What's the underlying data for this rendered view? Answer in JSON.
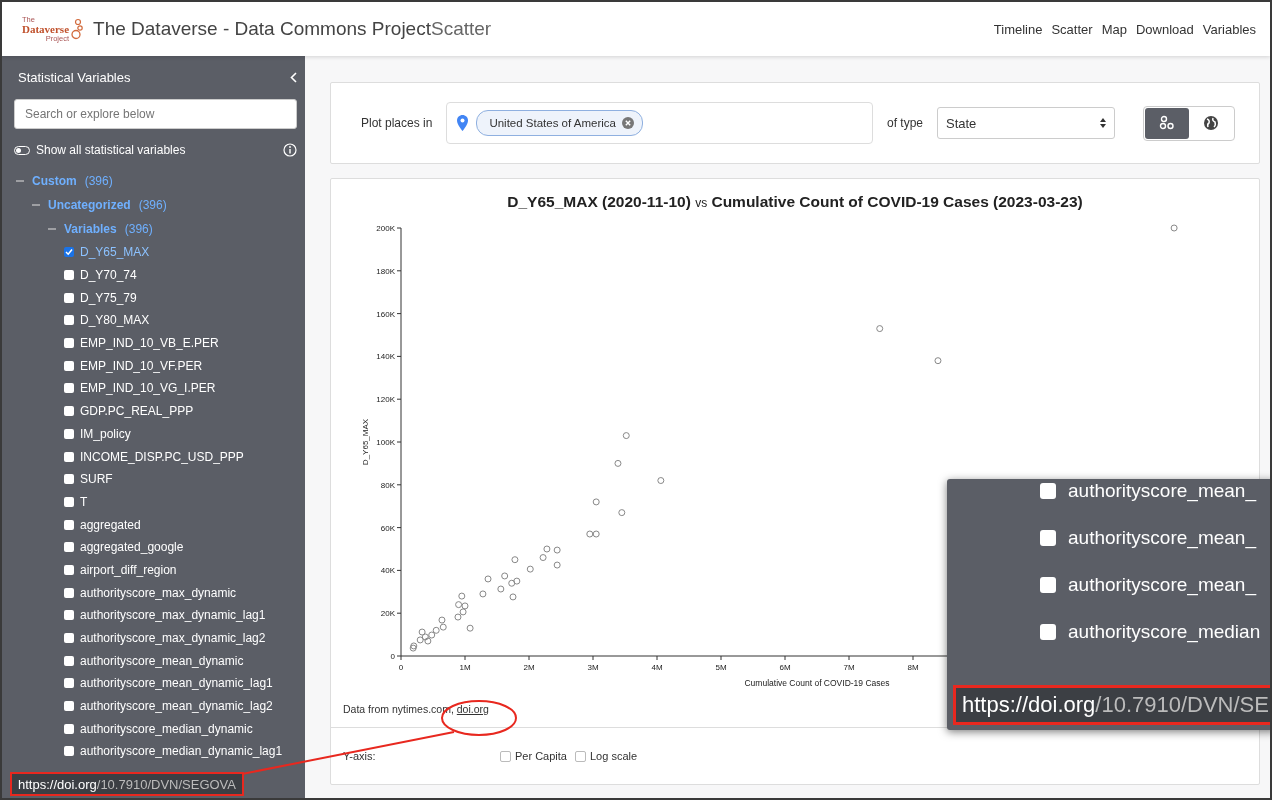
{
  "header": {
    "logo": {
      "top": "The",
      "main": "Dataverse",
      "bottom": "Project"
    },
    "title": "The Dataverse - Data Commons Project",
    "page": "Scatter",
    "nav": [
      "Timeline",
      "Scatter",
      "Map",
      "Download",
      "Variables"
    ]
  },
  "sidebar": {
    "title": "Statistical Variables",
    "search": {
      "placeholder": "Search or explore below"
    },
    "show_all": {
      "label": "Show all statistical variables",
      "on": false
    },
    "tree": [
      {
        "label": "Custom",
        "count": "(396)",
        "expanded": true,
        "children": [
          {
            "label": "Uncategorized",
            "count": "(396)",
            "expanded": true,
            "children": [
              {
                "label": "Variables",
                "count": "(396)",
                "expanded": true,
                "items": [
                  {
                    "label": "D_Y65_MAX",
                    "checked": true
                  },
                  {
                    "label": "D_Y70_74",
                    "checked": false
                  },
                  {
                    "label": "D_Y75_79",
                    "checked": false
                  },
                  {
                    "label": "D_Y80_MAX",
                    "checked": false
                  },
                  {
                    "label": "EMP_IND_10_VB_E.PER",
                    "checked": false
                  },
                  {
                    "label": "EMP_IND_10_VF.PER",
                    "checked": false
                  },
                  {
                    "label": "EMP_IND_10_VG_I.PER",
                    "checked": false
                  },
                  {
                    "label": "GDP.PC_REAL_PPP",
                    "checked": false
                  },
                  {
                    "label": "IM_policy",
                    "checked": false
                  },
                  {
                    "label": "INCOME_DISP.PC_USD_PPP",
                    "checked": false
                  },
                  {
                    "label": "SURF",
                    "checked": false
                  },
                  {
                    "label": "T",
                    "checked": false
                  },
                  {
                    "label": "aggregated",
                    "checked": false
                  },
                  {
                    "label": "aggregated_google",
                    "checked": false
                  },
                  {
                    "label": "airport_diff_region",
                    "checked": false
                  },
                  {
                    "label": "authorityscore_max_dynamic",
                    "checked": false
                  },
                  {
                    "label": "authorityscore_max_dynamic_lag1",
                    "checked": false
                  },
                  {
                    "label": "authorityscore_max_dynamic_lag2",
                    "checked": false
                  },
                  {
                    "label": "authorityscore_mean_dynamic",
                    "checked": false
                  },
                  {
                    "label": "authorityscore_mean_dynamic_lag1",
                    "checked": false
                  },
                  {
                    "label": "authorityscore_mean_dynamic_lag2",
                    "checked": false
                  },
                  {
                    "label": "authorityscore_median_dynamic",
                    "checked": false
                  },
                  {
                    "label": "authorityscore_median_dynamic_lag1",
                    "checked": false
                  }
                ]
              }
            ]
          }
        ]
      }
    ]
  },
  "place_card": {
    "label": "Plot places in",
    "chip": "United States of America",
    "type_label": "of type",
    "type_value": "State",
    "view_buttons": [
      {
        "kind": "scatter",
        "selected": true
      },
      {
        "kind": "map",
        "selected": false
      }
    ]
  },
  "chart_card": {
    "title": "**D_Y65_MAX (2020-11-10)** vs **Cumulative Count of COVID-19 Cases (2023-03-23)**",
    "chart_data": {
      "type": "scatter",
      "xlabel": "Cumulative Count of COVID-19 Cases",
      "ylabel": "D_Y65_MAX",
      "xlim": [
        0,
        13000000
      ],
      "ylim": [
        0,
        200000
      ],
      "xticks": [
        {
          "value": 0,
          "label": "0"
        },
        {
          "value": 1000000,
          "label": "1M"
        },
        {
          "value": 2000000,
          "label": "2M"
        },
        {
          "value": 3000000,
          "label": "3M"
        },
        {
          "value": 4000000,
          "label": "4M"
        },
        {
          "value": 5000000,
          "label": "5M"
        },
        {
          "value": 6000000,
          "label": "6M"
        },
        {
          "value": 7000000,
          "label": "7M"
        },
        {
          "value": 8000000,
          "label": "8M"
        }
      ],
      "yticks": [
        {
          "value": 0,
          "label": "0"
        },
        {
          "value": 20000,
          "label": "20K"
        },
        {
          "value": 40000,
          "label": "40K"
        },
        {
          "value": 60000,
          "label": "60K"
        },
        {
          "value": 80000,
          "label": "80K"
        },
        {
          "value": 100000,
          "label": "100K"
        },
        {
          "value": 120000,
          "label": "120K"
        },
        {
          "value": 140000,
          "label": "140K"
        },
        {
          "value": 160000,
          "label": "160K"
        },
        {
          "value": 180000,
          "label": "180K"
        },
        {
          "value": 200000,
          "label": "200K"
        }
      ],
      "x": [
        12080000,
        7480000,
        8390000,
        3520000,
        3390000,
        4060000,
        3050000,
        3450000,
        2950000,
        3050000,
        2280000,
        2440000,
        2220000,
        1780000,
        2440000,
        2020000,
        1620000,
        1360000,
        1810000,
        1730000,
        1560000,
        1280000,
        1750000,
        950000,
        900000,
        1000000,
        970000,
        890000,
        640000,
        1080000,
        660000,
        550000,
        330000,
        480000,
        380000,
        300000,
        420000,
        200000,
        190000
      ],
      "series": [
        {
          "color": "#888888",
          "values": [
            200000,
            153000,
            138000,
            103000,
            90000,
            82000,
            72000,
            67000,
            57000,
            57000,
            50000,
            49500,
            46000,
            45000,
            42500,
            40600,
            37400,
            36000,
            35000,
            34000,
            31300,
            29000,
            27600,
            28000,
            24000,
            23400,
            20600,
            18200,
            16800,
            13000,
            13500,
            12000,
            11200,
            9800,
            8900,
            7500,
            7000,
            4700,
            3700
          ]
        }
      ]
    },
    "source_prefix": "Data from nytimes.com, ",
    "source_link": "doi.org"
  },
  "options": {
    "label": "Y-axis:",
    "checks": [
      {
        "label": "Per Capita",
        "checked": false
      },
      {
        "label": "Log scale",
        "checked": false
      }
    ]
  },
  "status_url": {
    "host": "https://doi.org",
    "path": "/10.7910/DVN/SEGOVA"
  },
  "magnifier": {
    "items": [
      {
        "label": "authorityscore_mean_",
        "checked": false
      },
      {
        "label": "authorityscore_mean_",
        "checked": false
      },
      {
        "label": "authorityscore_mean_",
        "checked": false
      },
      {
        "label": "authorityscore_median",
        "checked": false
      }
    ],
    "url": {
      "host": "https://doi.org",
      "path": "/10.7910/DVN/SE"
    }
  }
}
